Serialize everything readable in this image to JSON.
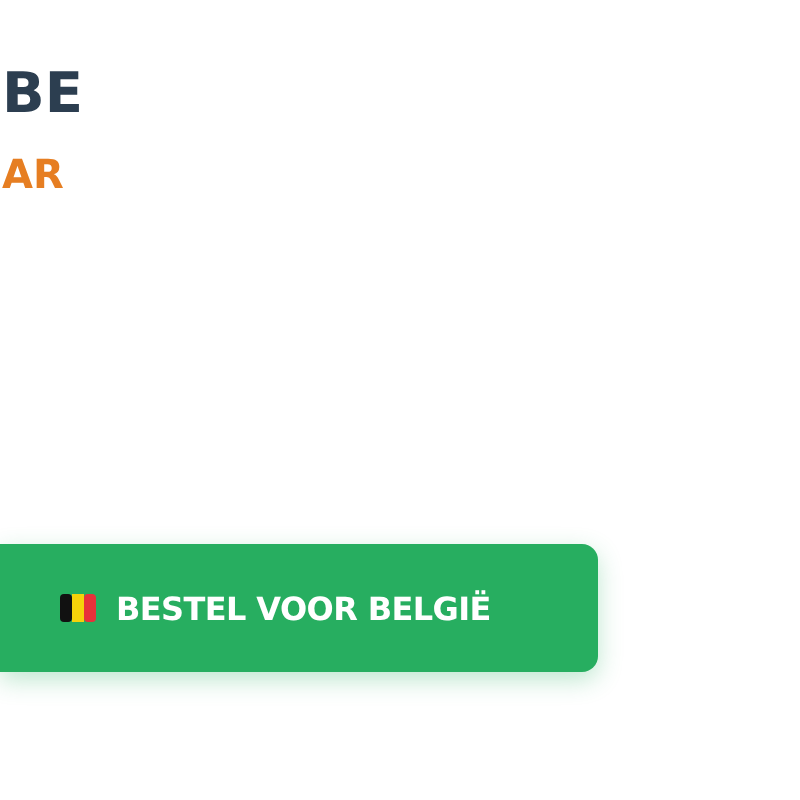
{
  "heading": "BE",
  "subheading": "AR",
  "order_button": {
    "label": "BESTEL VOOR BELGIË"
  }
}
